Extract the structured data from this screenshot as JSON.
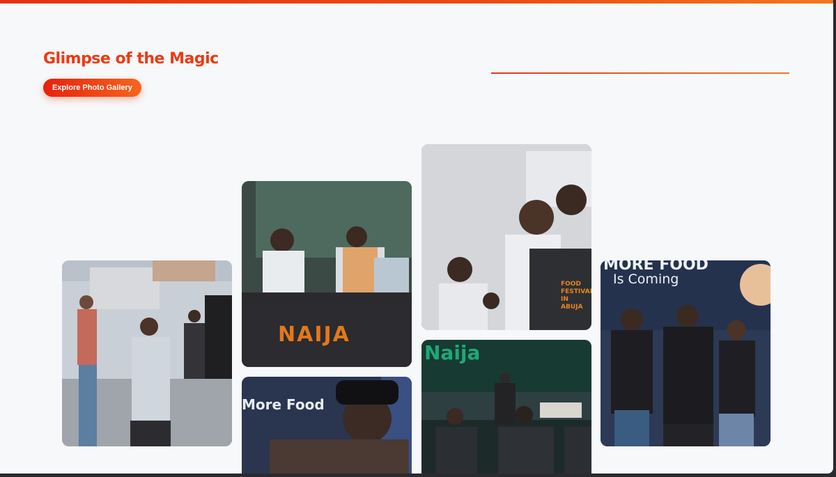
{
  "section": {
    "title": "Glimpse of the Magic",
    "cta_label": "Explore Photo Gallery"
  },
  "gallery": {
    "photos": [
      {
        "name": "crowd-eating-photo"
      },
      {
        "name": "chefs-cooking-photo",
        "banner_text": "NAIJA"
      },
      {
        "name": "chefs-hugging-photo",
        "apron_text": "FOOD FESTIVAL IN ABUJA"
      },
      {
        "name": "stage-team-photo",
        "screen_line1": "MORE FOOD",
        "screen_line2": "Is Coming",
        "shirt_text": "MORE FOOD Is Coming"
      },
      {
        "name": "man-on-stage-photo",
        "screen_text": "More Food"
      },
      {
        "name": "security-team-photo",
        "screen_text": "Naija"
      }
    ]
  },
  "colors": {
    "accent": "#ee3a12",
    "accent_end": "#f6651c",
    "background": "#f7f8fa"
  }
}
